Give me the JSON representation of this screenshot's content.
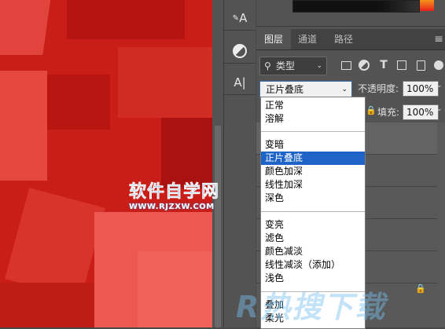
{
  "colors": {
    "accent": "#1e64c8",
    "canvas": "#c41a15",
    "panel": "#535353"
  },
  "panel_tabs": [
    {
      "label": "图层",
      "active": true
    },
    {
      "label": "通道",
      "active": false
    },
    {
      "label": "路径",
      "active": false
    }
  ],
  "filter": {
    "kind_label": "类型"
  },
  "blend": {
    "current": "正片叠底"
  },
  "opacity": {
    "label": "不透明度:",
    "value": "100%"
  },
  "fill": {
    "label": "填充:",
    "value": "100%"
  },
  "blend_modes": [
    {
      "label": "正常"
    },
    {
      "label": "溶解"
    },
    {
      "label": "变暗"
    },
    {
      "label": "正片叠底",
      "selected": true
    },
    {
      "label": "颜色加深"
    },
    {
      "label": "线性加深"
    },
    {
      "label": "深色"
    },
    {
      "label": "变亮"
    },
    {
      "label": "滤色"
    },
    {
      "label": "颜色减淡"
    },
    {
      "label": "线性减淡（添加）"
    },
    {
      "label": "浅色"
    },
    {
      "label": "叠加"
    },
    {
      "label": "柔光"
    }
  ],
  "watermark": {
    "main": "软件自学网",
    "url": "WWW.RJZXW.COM",
    "corner": "R热搜下载"
  },
  "tool_glyphs": {
    "char_tool": "A",
    "paragraph_tool": "A|"
  }
}
